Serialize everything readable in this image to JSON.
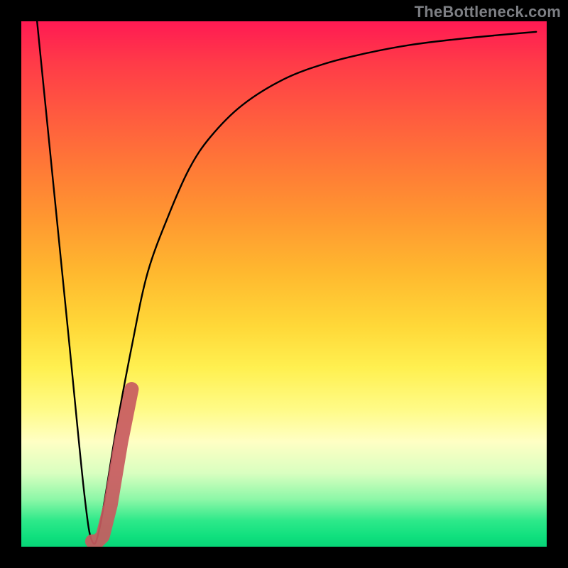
{
  "watermark": "TheBottleneck.com",
  "chart_data": {
    "type": "line",
    "title": "",
    "xlabel": "",
    "ylabel": "",
    "xlim": [
      0,
      100
    ],
    "ylim": [
      0,
      100
    ],
    "grid": false,
    "series": [
      {
        "name": "black-curve",
        "x": [
          3,
          6,
          9,
          12,
          13.5,
          15,
          18,
          21,
          24,
          28,
          32,
          36,
          42,
          50,
          58,
          66,
          74,
          82,
          90,
          98
        ],
        "y": [
          100,
          70,
          40,
          10,
          1,
          4,
          22,
          38,
          52,
          63,
          72,
          78,
          84,
          89,
          92,
          94,
          95.5,
          96.5,
          97.3,
          98
        ]
      },
      {
        "name": "marker-stroke",
        "x": [
          13.5,
          14.5,
          15.5,
          17,
          18,
          19,
          20,
          21
        ],
        "y": [
          1,
          1,
          2,
          8,
          14,
          20,
          25,
          30
        ]
      }
    ]
  }
}
